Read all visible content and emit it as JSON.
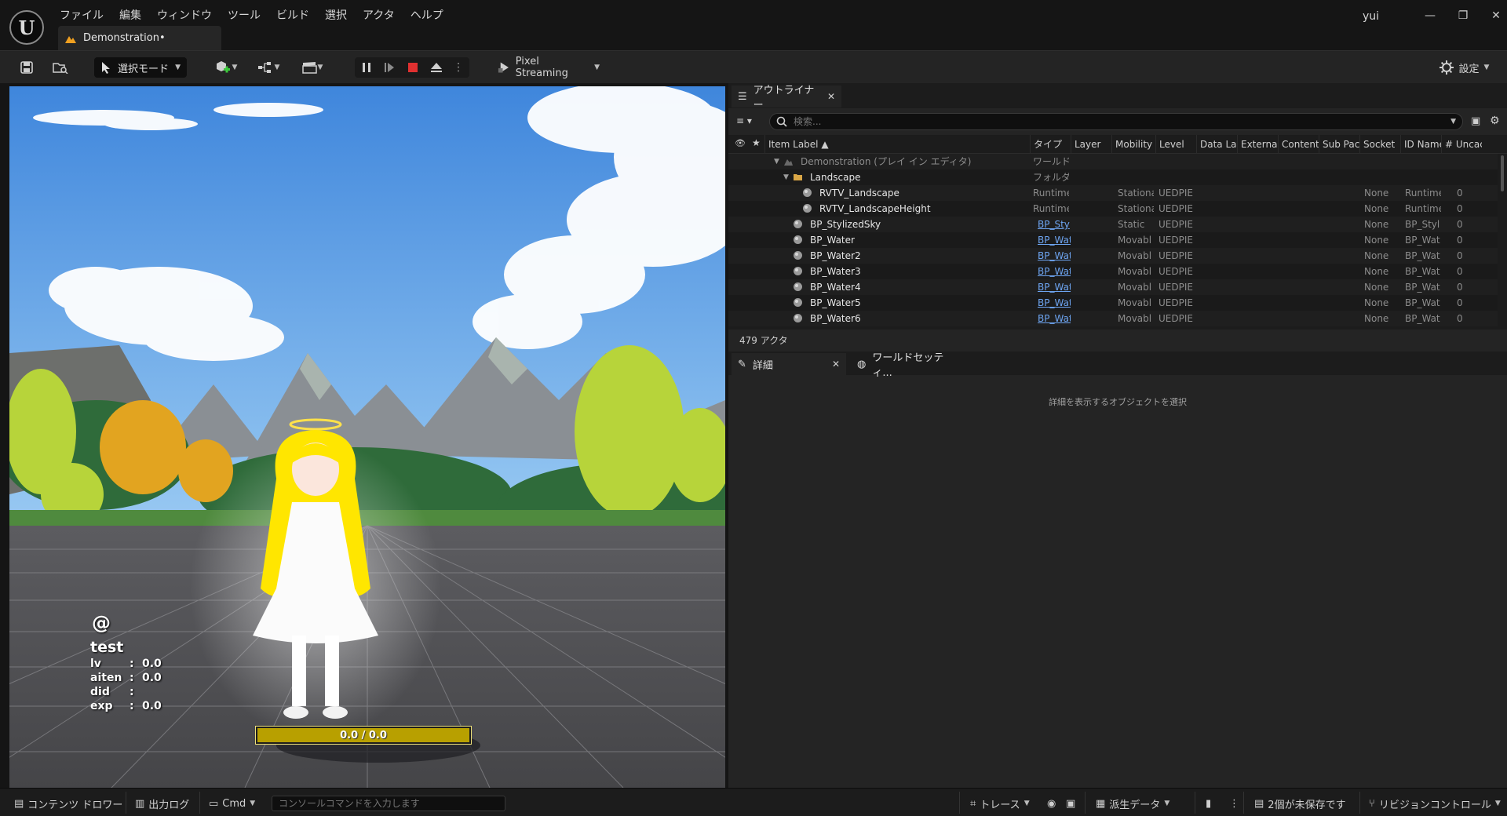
{
  "app": {
    "user": "yui",
    "document_tab": "Demonstration•"
  },
  "menu": [
    "ファイル",
    "編集",
    "ウィンドウ",
    "ツール",
    "ビルド",
    "選択",
    "アクタ",
    "ヘルプ"
  ],
  "window_controls": {
    "minimize": "—",
    "restore": "❐",
    "close": "✕"
  },
  "toolbar": {
    "mode_label": "選択モード",
    "pixel_streaming_label": "Pixel Streaming",
    "settings_label": "設定"
  },
  "viewport": {
    "hud": {
      "at_symbol": "@",
      "name": "test",
      "rows": [
        {
          "key": "lv",
          "sep": ":",
          "value": "0.0"
        },
        {
          "key": "aiten",
          "sep": ":",
          "value": "0.0"
        },
        {
          "key": "did",
          "sep": ":",
          "value": ""
        },
        {
          "key": "exp",
          "sep": ":",
          "value": "0.0"
        }
      ]
    },
    "hp_bar_text": "0.0 / 0.0"
  },
  "outliner": {
    "tab_label": "アウトライナー",
    "search_placeholder": "検索...",
    "columns": [
      "Item Label ▲",
      "タイプ",
      "Layer",
      "Mobility",
      "Level",
      "Data Lay",
      "External",
      "Content",
      "Sub Pac",
      "Socket",
      "ID Name",
      "# Uncac"
    ],
    "rows": [
      {
        "label": "Demonstration (プレイ イン エディタ)",
        "type": "ワールド",
        "mobility": "",
        "level": "",
        "socket": "",
        "id_name": "",
        "uncached": "",
        "kind": "world"
      },
      {
        "label": "Landscape",
        "type": "フォルダ",
        "mobility": "",
        "level": "",
        "socket": "",
        "id_name": "",
        "uncached": "",
        "kind": "folder"
      },
      {
        "label": "RVTV_Landscape",
        "type": "Runtime",
        "mobility": "Stationa",
        "level": "UEDPIE",
        "socket": "None",
        "id_name": "Runtime",
        "uncached": "0",
        "kind": "child"
      },
      {
        "label": "RVTV_LandscapeHeight",
        "type": "Runtime",
        "mobility": "Stationa",
        "level": "UEDPIE",
        "socket": "None",
        "id_name": "Runtime",
        "uncached": "0",
        "kind": "child"
      },
      {
        "label": "BP_StylizedSky",
        "type": "BP_Sty",
        "mobility": "Static",
        "level": "UEDPIE",
        "socket": "None",
        "id_name": "BP_Styl",
        "uncached": "0",
        "kind": "actor"
      },
      {
        "label": "BP_Water",
        "type": "BP_Wat",
        "mobility": "Movabl",
        "level": "UEDPIE",
        "socket": "None",
        "id_name": "BP_Wat",
        "uncached": "0",
        "kind": "actor"
      },
      {
        "label": "BP_Water2",
        "type": "BP_Wat",
        "mobility": "Movabl",
        "level": "UEDPIE",
        "socket": "None",
        "id_name": "BP_Wat",
        "uncached": "0",
        "kind": "actor"
      },
      {
        "label": "BP_Water3",
        "type": "BP_Wat",
        "mobility": "Movabl",
        "level": "UEDPIE",
        "socket": "None",
        "id_name": "BP_Wat",
        "uncached": "0",
        "kind": "actor"
      },
      {
        "label": "BP_Water4",
        "type": "BP_Wat",
        "mobility": "Movabl",
        "level": "UEDPIE",
        "socket": "None",
        "id_name": "BP_Wat",
        "uncached": "0",
        "kind": "actor"
      },
      {
        "label": "BP_Water5",
        "type": "BP_Wat",
        "mobility": "Movabl",
        "level": "UEDPIE",
        "socket": "None",
        "id_name": "BP_Wat",
        "uncached": "0",
        "kind": "actor"
      },
      {
        "label": "BP_Water6",
        "type": "BP_Wat",
        "mobility": "Movabl",
        "level": "UEDPIE",
        "socket": "None",
        "id_name": "BP_Wat",
        "uncached": "0",
        "kind": "actor"
      }
    ],
    "footer": "479 アクタ"
  },
  "details": {
    "tab_label": "詳細",
    "world_settings_tab": "ワールドセッティ...",
    "empty_message": "詳細を表示するオブジェクトを選択"
  },
  "statusbar": {
    "content_drawer": "コンテンツ ドロワー",
    "output_log": "出力ログ",
    "cmd": "Cmd",
    "console_placeholder": "コンソールコマンドを入力します",
    "trace": "トレース",
    "derived_data": "派生データ",
    "unsaved": "2個が未保存です",
    "revision_control": "リビジョンコントロール"
  },
  "colors": {
    "accent_orange": "#f0a020",
    "link_blue": "#6da4f0",
    "stop_red": "#e03030",
    "hp_bar_fill": "#b8a000"
  }
}
